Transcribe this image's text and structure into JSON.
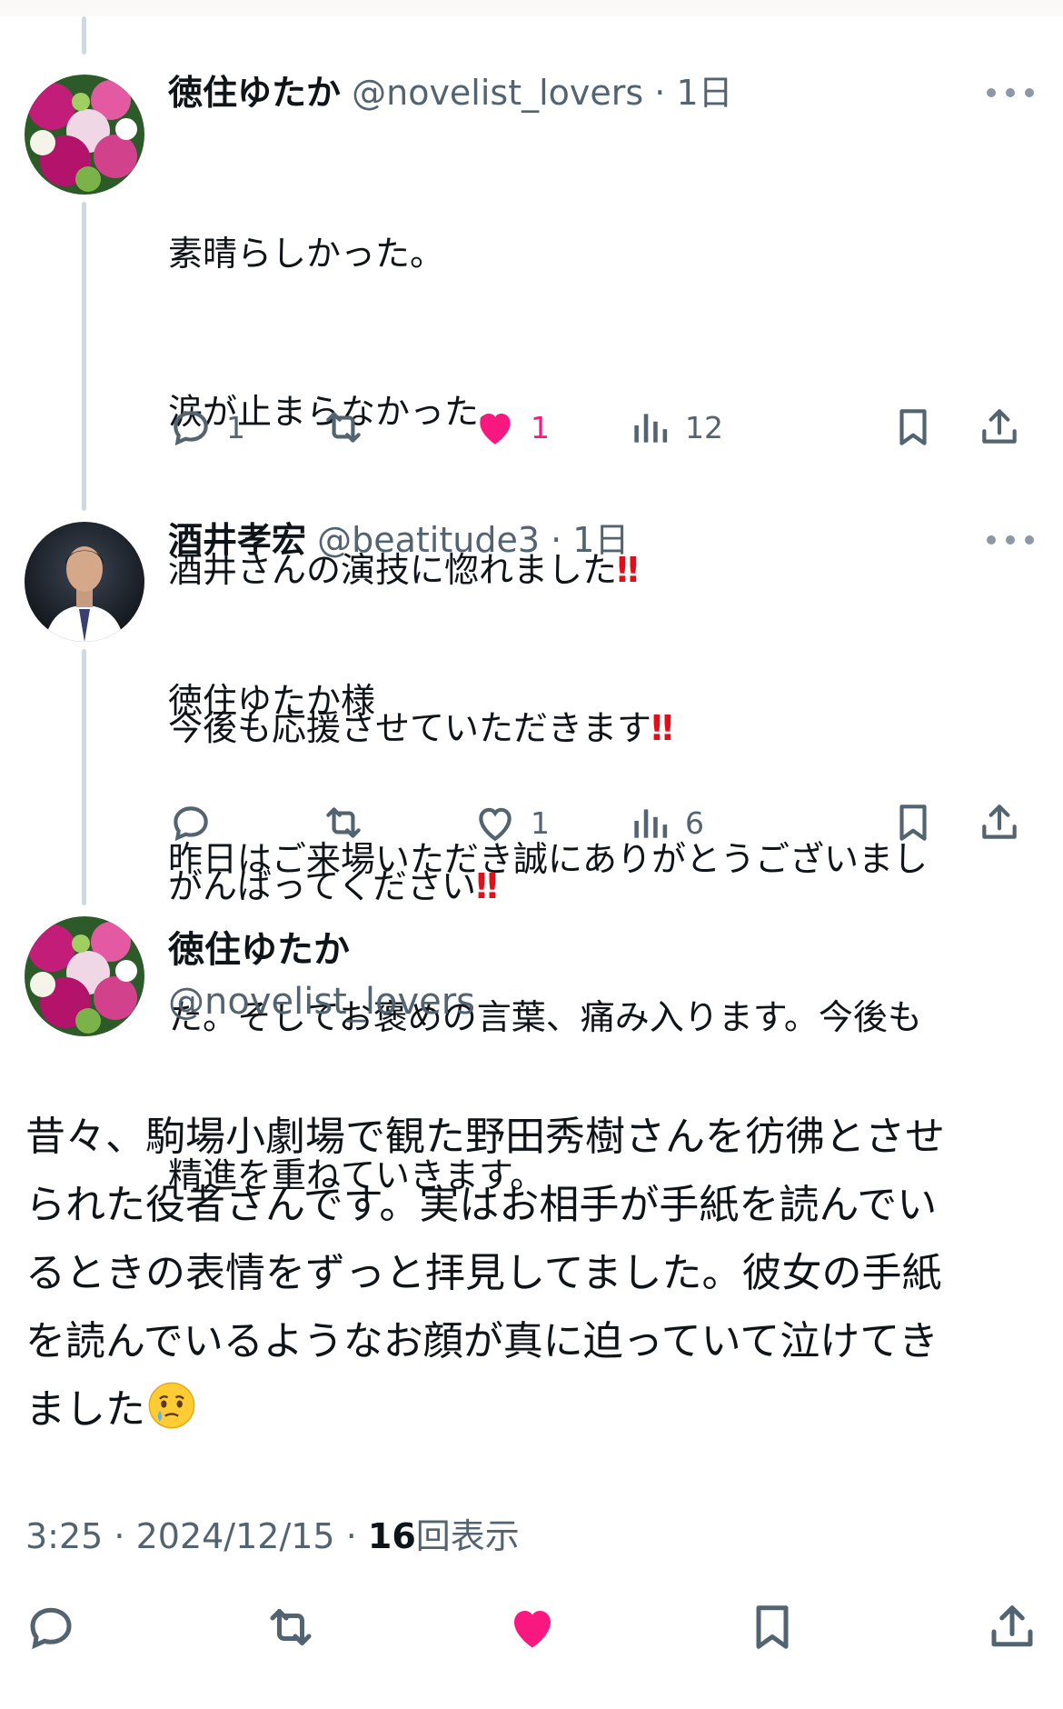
{
  "tweets": [
    {
      "name": "徳住ゆたか",
      "handle": "@novelist_lovers",
      "sep": " · ",
      "time": "1日",
      "lines": [
        "素晴らしかった。",
        "涙が止まらなかった。",
        "酒井さんの演技に惚れました",
        "今後も応援させていただきます",
        "がんばってください"
      ],
      "emphasis": "‼",
      "counts": {
        "reply": "1",
        "retweet": "",
        "like": "1",
        "views": "12"
      }
    },
    {
      "name": "酒井孝宏",
      "handle": "@beatitude3",
      "sep": " · ",
      "time": "1日",
      "lines": [
        "徳住ゆたか様",
        "昨日はご来場いただき誠にありがとうございまし",
        "た。そしてお褒めの言葉、痛み入ります。今後も",
        "精進を重ねていきます。"
      ],
      "counts": {
        "reply": "",
        "retweet": "",
        "like": "1",
        "views": "6"
      }
    }
  ],
  "main_tweet": {
    "name": "徳住ゆたか",
    "handle": "@novelist_lovers",
    "lines": [
      "昔々、駒場小劇場で観た野田秀樹さんを彷彿とさせ",
      "られた役者さんです。実はお相手が手紙を読んでい",
      "るときの表情をずっと拝見してました。彼女の手紙",
      "を読んでいるようなお顔が真に迫っていて泣けてき",
      "ました"
    ],
    "emoji": "face-holding-back-tears-emoji",
    "time": "3:25",
    "date": "2024/12/15",
    "dot": " · ",
    "views": "16",
    "views_label": "回表示"
  },
  "colors": {
    "like": "#f91880",
    "secondary": "#536471",
    "thread_line": "#cfd9de",
    "emphasis": "#e0101b"
  }
}
